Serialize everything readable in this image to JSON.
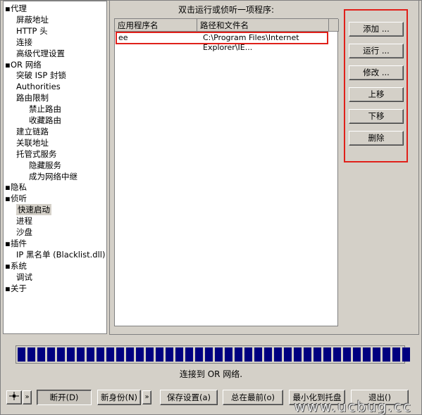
{
  "tree": {
    "items": [
      {
        "label": "代理",
        "bullet": true,
        "indent": 0
      },
      {
        "label": "屏蔽地址",
        "indent": 1
      },
      {
        "label": "HTTP 头",
        "indent": 1
      },
      {
        "label": "连接",
        "indent": 1
      },
      {
        "label": "高级代理设置",
        "indent": 1
      },
      {
        "label": "OR 网络",
        "bullet": true,
        "indent": 0
      },
      {
        "label": "突破 ISP 封锁",
        "indent": 1
      },
      {
        "label": "Authorities",
        "indent": 1
      },
      {
        "label": "路由限制",
        "indent": 1
      },
      {
        "label": "禁止路由",
        "indent": 2
      },
      {
        "label": "收藏路由",
        "indent": 2
      },
      {
        "label": "建立链路",
        "indent": 1
      },
      {
        "label": "关联地址",
        "indent": 1
      },
      {
        "label": "托管式服务",
        "indent": 1
      },
      {
        "label": "隐藏服务",
        "indent": 2
      },
      {
        "label": "成为网络中继",
        "indent": 2
      },
      {
        "label": "隐私",
        "bullet": true,
        "indent": 0
      },
      {
        "label": "侦听",
        "bullet": true,
        "indent": 0
      },
      {
        "label": "快速启动",
        "indent": 1,
        "selected": true
      },
      {
        "label": "进程",
        "indent": 1
      },
      {
        "label": "沙盘",
        "indent": 1
      },
      {
        "label": "插件",
        "bullet": true,
        "indent": 0
      },
      {
        "label": "IP 黑名单 (Blacklist.dll)",
        "indent": 1
      },
      {
        "label": "系统",
        "bullet": true,
        "indent": 0
      },
      {
        "label": "调试",
        "indent": 1
      },
      {
        "label": "关于",
        "bullet": true,
        "indent": 0
      }
    ]
  },
  "panel": {
    "caption": "双击运行或侦听一项程序:",
    "columns": [
      "应用程序名",
      "路径和文件名"
    ],
    "rows": [
      {
        "app": "ee",
        "path": "C:\\Program Files\\Internet Explorer\\IE..."
      }
    ]
  },
  "actions": {
    "add": "添加 ...",
    "run": "运行 ...",
    "edit": "修改 ...",
    "up": "上移",
    "down": "下移",
    "delete": "删除"
  },
  "progress": {
    "segments": 40
  },
  "status": "连接到 OR 网络.",
  "bottom": {
    "nav_arrow": "»",
    "nav_arrow2": "»",
    "disconnect": "断开(D)",
    "new_identity": "新身份(N)",
    "new_identity_arrow": "»",
    "save_settings": "保存设置(a)",
    "always_top": "总在最前(o)",
    "minimize_tray": "最小化到托盘",
    "exit": "退出()"
  },
  "watermark": "www.ucbug.cc"
}
